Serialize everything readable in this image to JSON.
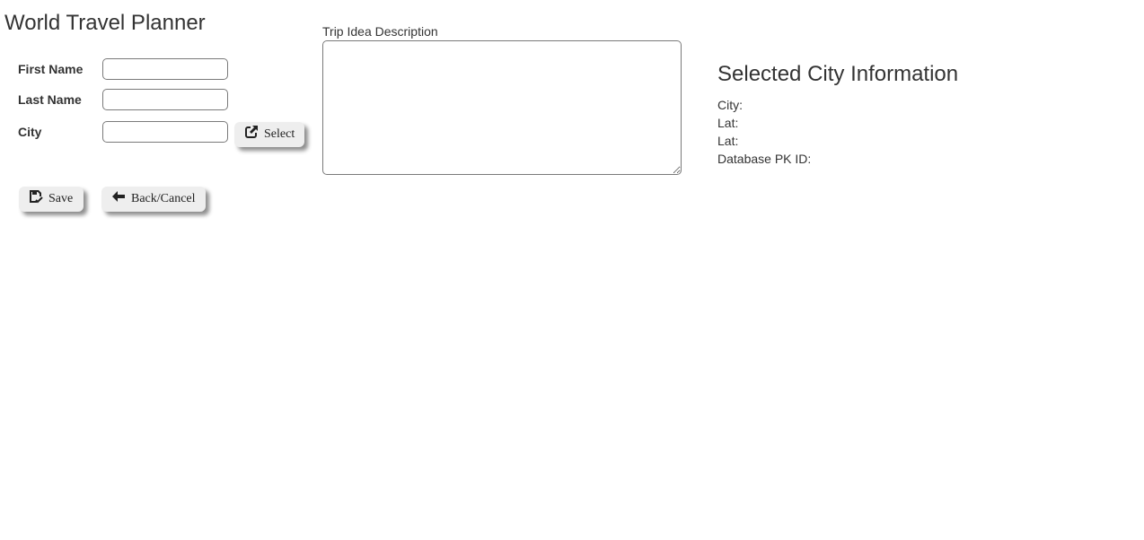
{
  "app": {
    "title": "World Travel Planner"
  },
  "form": {
    "first_name": {
      "label": "First Name",
      "value": ""
    },
    "last_name": {
      "label": "Last Name",
      "value": ""
    },
    "city": {
      "label": "City",
      "value": ""
    },
    "select_button": {
      "label": "Select",
      "icon": "external-link-icon"
    },
    "save_button": {
      "label": "Save",
      "icon": "save-icon"
    },
    "back_button": {
      "label": "Back/Cancel",
      "icon": "arrow-left-icon"
    }
  },
  "description": {
    "label": "Trip Idea Description",
    "value": ""
  },
  "city_info": {
    "title": "Selected City Information",
    "city_label": "City:",
    "lat_label": "Lat:",
    "lat2_label": "Lat:",
    "pk_label": "Database PK ID:"
  }
}
